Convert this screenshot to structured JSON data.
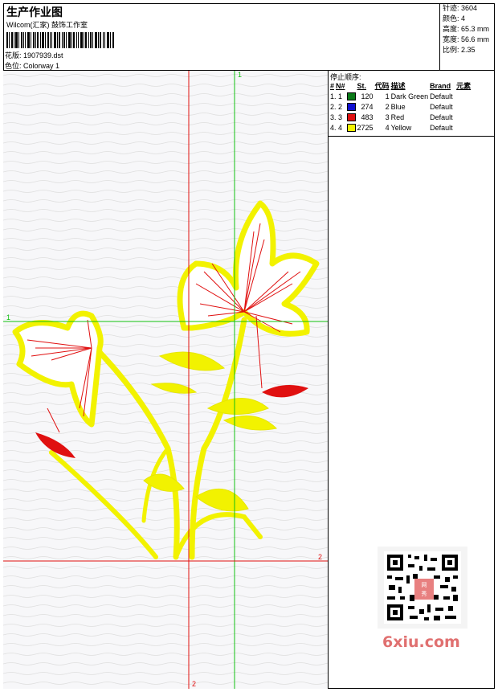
{
  "header": {
    "title": "生产作业图",
    "company": "Wilcom(汇家) 鼓饰工作室",
    "design_label": "花版: 1907939.dst",
    "colorway_label": "色位: Colorway 1"
  },
  "stats": {
    "stitches": "针迹: 3604",
    "colors": "颜色: 4",
    "height": "高度: 65.3 mm",
    "width": "宽度: 56.6 mm",
    "scale": "比例: 2.35"
  },
  "stop_sequence": {
    "title": "停止顺序:",
    "columns": [
      "#",
      "N#",
      "St.",
      "代码",
      "描述",
      "Brand",
      "元素"
    ],
    "rows": [
      {
        "idx": "1. 1",
        "color": "#0b7a18",
        "st": "120",
        "code": "1",
        "desc": "Dark Green",
        "brand": "Default"
      },
      {
        "idx": "2. 2",
        "color": "#1010d0",
        "st": "274",
        "code": "2",
        "desc": "Blue",
        "brand": "Default"
      },
      {
        "idx": "3. 3",
        "color": "#e01010",
        "st": "483",
        "code": "3",
        "desc": "Red",
        "brand": "Default"
      },
      {
        "idx": "4. 4",
        "color": "#f2f200",
        "st": "2725",
        "code": "4",
        "desc": "Yellow",
        "brand": "Default"
      }
    ]
  },
  "guides": {
    "green_h": "1",
    "green_v": "1",
    "red_h": "2",
    "red_v": "2"
  },
  "watermark": "6xiu.com",
  "colors": {
    "red": "#e01010",
    "green": "#10c010",
    "yellow": "#f2f200",
    "dark": "#222222"
  }
}
